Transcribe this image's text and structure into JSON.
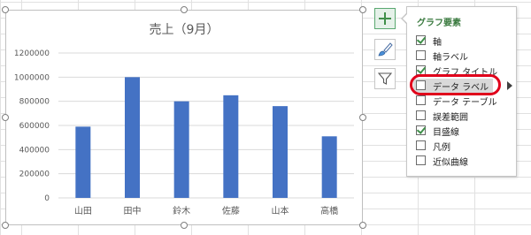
{
  "chart": {
    "title": "売上（9月）"
  },
  "chart_data": {
    "type": "bar",
    "title": "売上（9月）",
    "categories": [
      "山田",
      "田中",
      "鈴木",
      "佐藤",
      "山本",
      "高橋"
    ],
    "values": [
      590000,
      1000000,
      800000,
      850000,
      760000,
      510000
    ],
    "yticks": [
      "0",
      "200000",
      "400000",
      "600000",
      "800000",
      "1000000",
      "1200000"
    ],
    "ylim": [
      0,
      1200000
    ],
    "grid": true,
    "legend": false,
    "bar_color": "#4472c4",
    "gridline_color": "#d9d9d9"
  },
  "tools": {
    "elements_icon": "plus-icon",
    "styles_icon": "paintbrush-icon",
    "filter_icon": "funnel-icon"
  },
  "panel": {
    "title": "グラフ要素",
    "items": [
      {
        "label": "軸",
        "checked": true
      },
      {
        "label": "軸ラベル",
        "checked": false
      },
      {
        "label": "グラフ タイトル",
        "checked": true
      },
      {
        "label": "データ ラベル",
        "checked": false
      },
      {
        "label": "データ テーブル",
        "checked": false
      },
      {
        "label": "誤差範囲",
        "checked": false
      },
      {
        "label": "目盛線",
        "checked": true
      },
      {
        "label": "凡例",
        "checked": false
      },
      {
        "label": "近似曲線",
        "checked": false
      }
    ]
  },
  "colors": {
    "accent_green": "#3a7a3f",
    "highlight_red": "#e0001b"
  }
}
